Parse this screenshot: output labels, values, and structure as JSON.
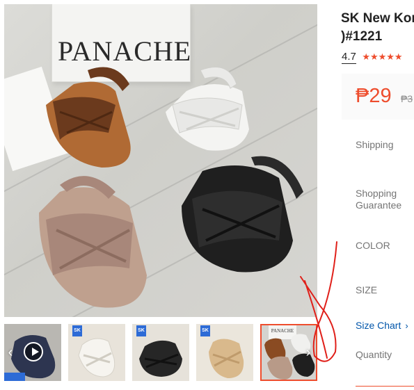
{
  "product": {
    "title_line1": "SK New Kor",
    "title_line2": ")#1221",
    "rating": "4.7",
    "stars": "★★★★★",
    "price_current": "₱29",
    "price_old": "₱3"
  },
  "brand_bag": {
    "text": "PANACHE"
  },
  "thumbnail_bag": {
    "text": "PANACHE"
  },
  "thumbnail_badge": "SK",
  "labels": {
    "shipping": "Shipping",
    "guarantee_line1": "Shopping",
    "guarantee_line2": "Guarantee",
    "color": "COLOR",
    "size": "SIZE",
    "size_chart": "Size Chart",
    "quantity": "Quantity"
  },
  "icons": {
    "prev": "chevron-left-icon",
    "next": "chevron-right-icon",
    "play": "play-icon",
    "size_chart_chevron": "chevron-right-icon"
  },
  "colors": {
    "accent": "#ee4d2d",
    "link": "#0055aa",
    "annotation": "#e0201a"
  }
}
